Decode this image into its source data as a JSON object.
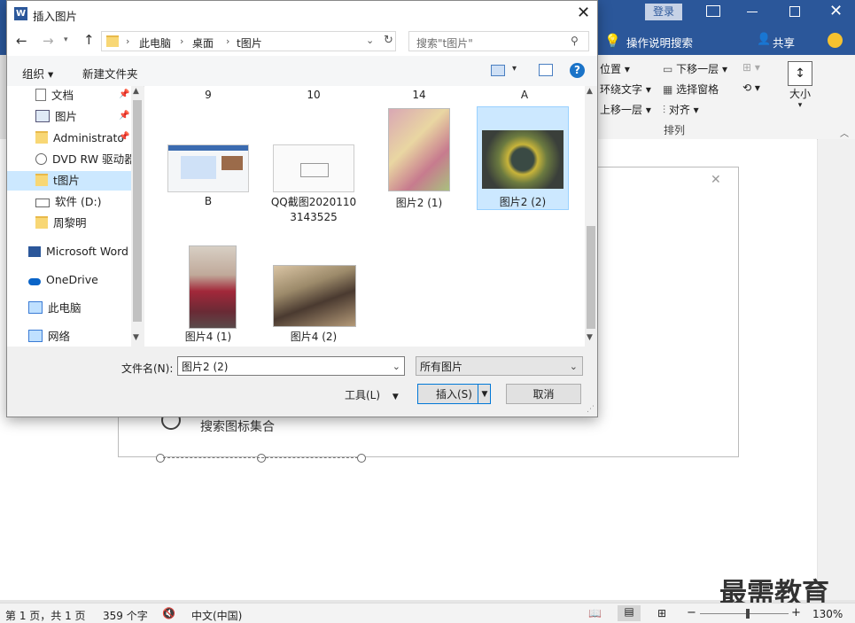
{
  "dialog": {
    "title": "插入图片",
    "address": {
      "crumbs": [
        "此电脑",
        "桌面",
        "t图片"
      ],
      "search_placeholder": "搜索\"t图片\""
    },
    "commands": {
      "organize": "组织",
      "new_folder": "新建文件夹"
    },
    "nav_items": [
      "文档",
      "图片",
      "Administrato",
      "DVD RW 驱动器",
      "t图片",
      "软件 (D:)",
      "周黎明",
      "Microsoft Word",
      "OneDrive",
      "此电脑",
      "网络"
    ],
    "files_row0": [
      "9",
      "10",
      "14",
      "A"
    ],
    "files": [
      {
        "label": "B"
      },
      {
        "label": "QQ截图20201103143525"
      },
      {
        "label": "图片2 (1)"
      },
      {
        "label": "图片2 (2)",
        "selected": true
      },
      {
        "label": "图片4 (1)"
      },
      {
        "label": "图片4 (2)"
      }
    ],
    "filename_label": "文件名(N):",
    "filename_value": "图片2 (2)",
    "filetype_value": "所有图片",
    "tools_label": "工具(L)",
    "insert_label": "插入(S)",
    "cancel_label": "取消"
  },
  "word": {
    "login": "登录",
    "tell_me": "操作说明搜索",
    "share": "共享",
    "ribbon": {
      "position": "位置",
      "wrap_text": "环绕文字",
      "bring_forward": "上移一层",
      "send_backward": "下移一层",
      "selection_pane": "选择窗格",
      "align": "对齐",
      "size": "大小",
      "group_label": "排列"
    },
    "doc_text": "搜索图标集合",
    "status": {
      "page": "第 1 页，共 1 页",
      "words": "359 个字",
      "language": "中文(中国)",
      "zoom": "130%"
    },
    "watermark": "最需教育"
  },
  "colors": {
    "word_blue": "#2b579a",
    "selection": "#cce8ff",
    "accent": "#0078d7"
  }
}
